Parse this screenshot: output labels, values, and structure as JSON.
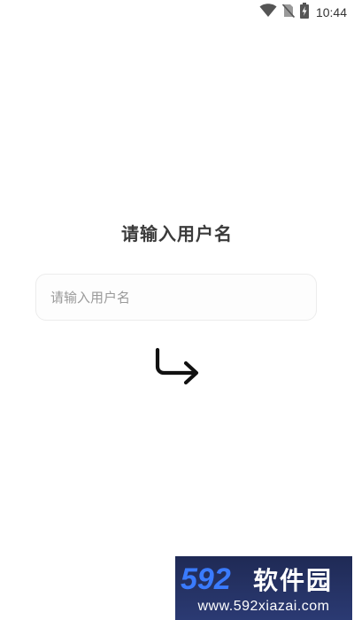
{
  "status_bar": {
    "time": "10:44",
    "icons": [
      "wifi-icon",
      "no-sim-icon",
      "battery-charging-icon"
    ]
  },
  "title": "请输入用户名",
  "username_input": {
    "placeholder": "请输入用户名",
    "value": ""
  },
  "submit": {
    "icon": "turn-right-arrow-icon"
  },
  "watermark": {
    "logo_text": "592软件园",
    "url": "www.592xiazai.com"
  },
  "colors": {
    "title": "#3b3b3b",
    "placeholder": "#9a9a9a",
    "input_border": "#ececec",
    "arrow": "#111111",
    "watermark_bg": "#1f2a55"
  }
}
